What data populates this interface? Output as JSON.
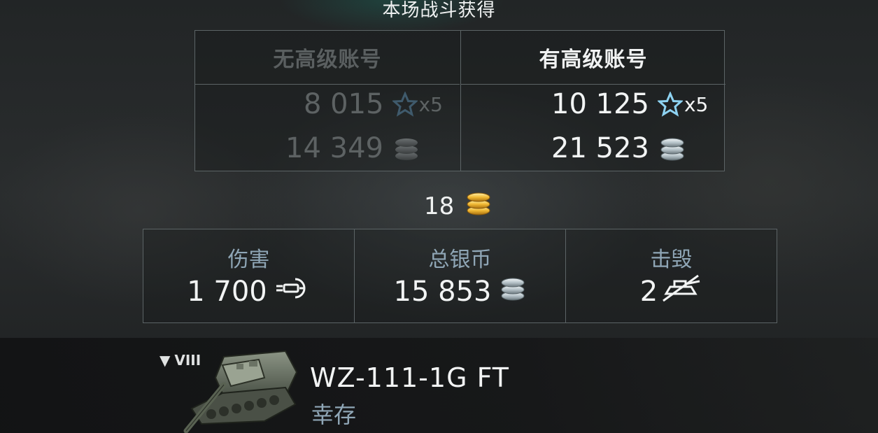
{
  "title": "本场战斗获得",
  "earnings": {
    "no_premium": {
      "header": "无高级账号",
      "xp": "8 015",
      "xp_multiplier": "x5",
      "credits": "14 349"
    },
    "premium": {
      "header": "有高级账号",
      "xp": "10 125",
      "xp_multiplier": "x5",
      "credits": "21 523"
    }
  },
  "gold": {
    "value": "18",
    "icon": "gold-coins-icon"
  },
  "stats": [
    {
      "label": "伤害",
      "value": "1 700",
      "icon": "damage-shell-icon"
    },
    {
      "label": "总银币",
      "value": "15 853",
      "icon": "silver-coins-icon"
    },
    {
      "label": "击毁",
      "value": "2",
      "icon": "destroyed-tank-icon"
    }
  ],
  "vehicle": {
    "tier": "VIII",
    "tier_marker": "▼",
    "name": "WZ-111-1G FT",
    "status": "幸存",
    "image": "tank-destroyer-icon"
  },
  "colors": {
    "label_blue": "#8fa6b6",
    "border": "#5c6466",
    "disabled_text": "#5d6263",
    "gold": "#e7b83a",
    "silver": "#b9c6cc"
  }
}
